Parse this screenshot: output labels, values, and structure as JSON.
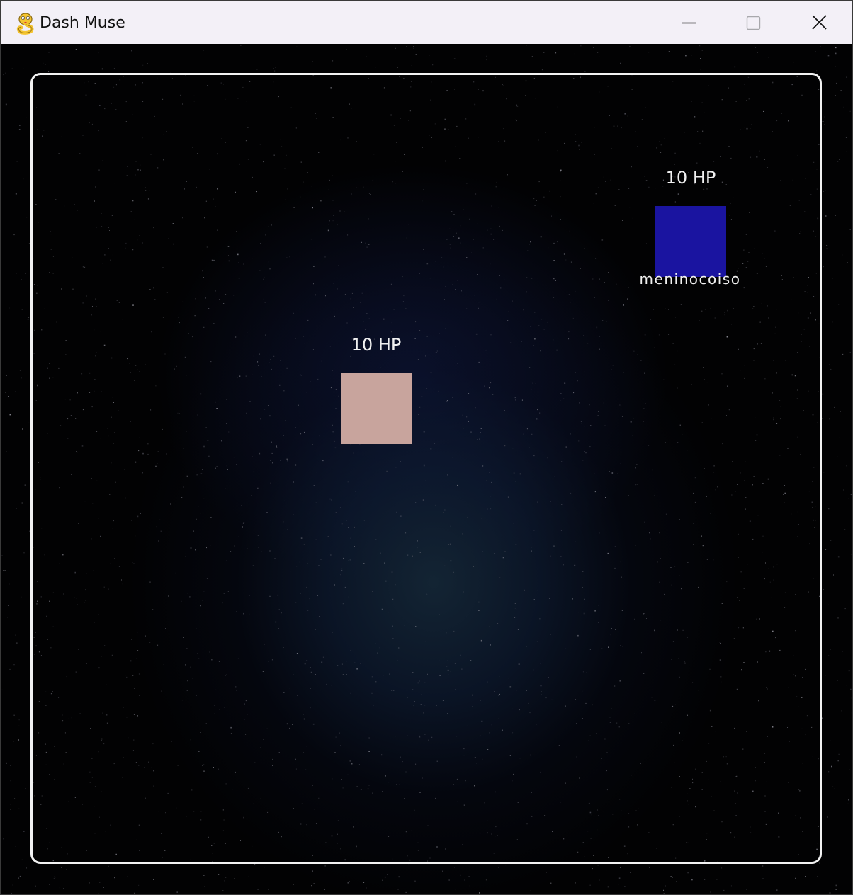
{
  "window": {
    "title": "Dash Muse"
  },
  "icons": {
    "app": "python-snake-icon",
    "minimize": "minimize-icon",
    "maximize": "maximize-icon",
    "close": "close-icon"
  },
  "colors": {
    "titlebar": "#f3f0f7",
    "background": "#020203",
    "arena_border": "#f2f2f2",
    "player_square": "#1a14a0",
    "enemy_square": "#c8a49d",
    "text": "#f0f0f0"
  },
  "players": [
    {
      "name": "meninocoiso",
      "hp_text": "10 HP",
      "color": "#1a14a0"
    }
  ],
  "enemies": [
    {
      "hp_text": "10 HP",
      "color": "#c8a49d"
    }
  ]
}
